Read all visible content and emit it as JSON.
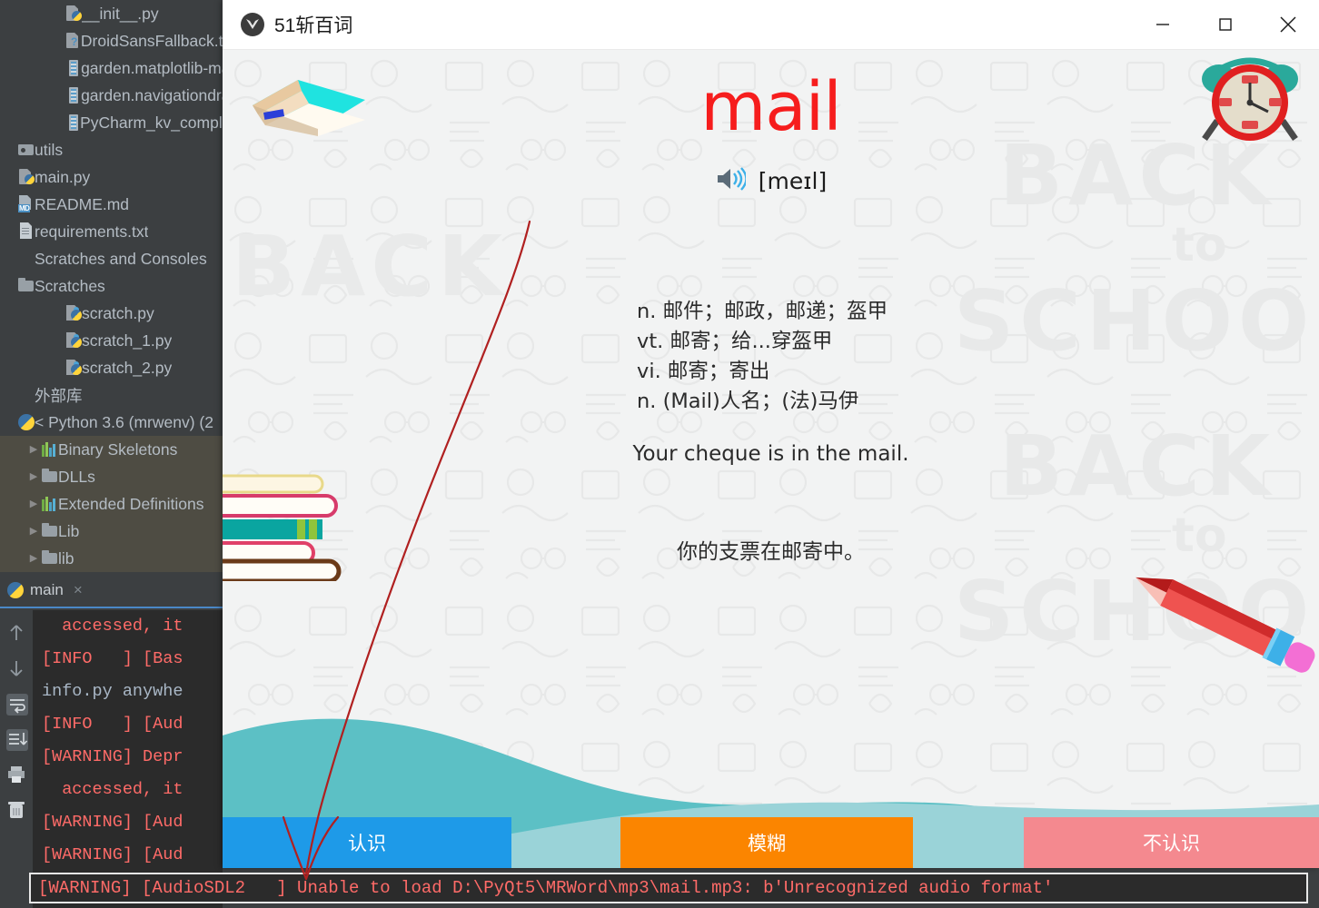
{
  "ide": {
    "tree": {
      "items": [
        {
          "label": "__init__.py",
          "icon": "python-file-icon",
          "indent": 2,
          "arrow": "",
          "selected": false
        },
        {
          "label": "DroidSansFallback.ttf",
          "icon": "unknown-file-icon",
          "indent": 2,
          "arrow": "",
          "selected": false
        },
        {
          "label": "garden.matplotlib-ma",
          "icon": "kv-file-icon",
          "indent": 2,
          "arrow": "",
          "selected": false
        },
        {
          "label": "garden.navigationdra",
          "icon": "kv-file-icon",
          "indent": 2,
          "arrow": "",
          "selected": false
        },
        {
          "label": "PyCharm_kv_completi",
          "icon": "kv-file-icon",
          "indent": 2,
          "arrow": "",
          "selected": false
        },
        {
          "label": "utils",
          "icon": "folder-module-icon",
          "indent": 0,
          "arrow": "",
          "selected": false
        },
        {
          "label": "main.py",
          "icon": "python-file-icon",
          "indent": 0,
          "arrow": "",
          "selected": false
        },
        {
          "label": "README.md",
          "icon": "markdown-file-icon",
          "indent": 0,
          "arrow": "",
          "selected": false
        },
        {
          "label": "requirements.txt",
          "icon": "text-file-icon",
          "indent": 0,
          "arrow": "",
          "selected": false
        },
        {
          "label": "Scratches and Consoles",
          "icon": "none",
          "indent": 0,
          "arrow": "",
          "selected": false
        },
        {
          "label": "Scratches",
          "icon": "folder-icon",
          "indent": 0,
          "arrow": "",
          "selected": false
        },
        {
          "label": "scratch.py",
          "icon": "scratch-file-icon",
          "indent": 2,
          "arrow": "",
          "selected": false
        },
        {
          "label": "scratch_1.py",
          "icon": "scratch-file-icon",
          "indent": 2,
          "arrow": "",
          "selected": false
        },
        {
          "label": "scratch_2.py",
          "icon": "scratch-file-icon",
          "indent": 2,
          "arrow": "",
          "selected": false
        },
        {
          "label": "外部库",
          "icon": "none",
          "indent": 0,
          "arrow": "",
          "selected": false
        },
        {
          "label": "< Python 3.6 (mrwenv) (2",
          "icon": "python-interpreter-icon",
          "indent": 0,
          "arrow": "",
          "selected": false
        },
        {
          "label": "Binary Skeletons",
          "icon": "skeleton-bars-icon",
          "indent": 1,
          "arrow": "▶",
          "selected": true
        },
        {
          "label": "DLLs",
          "icon": "folder-icon",
          "indent": 1,
          "arrow": "▶",
          "selected": true
        },
        {
          "label": "Extended Definitions",
          "icon": "skeleton-bars-icon",
          "indent": 1,
          "arrow": "▶",
          "selected": true
        },
        {
          "label": "Lib",
          "icon": "folder-icon",
          "indent": 1,
          "arrow": "▶",
          "selected": true
        },
        {
          "label": "lib",
          "icon": "folder-icon",
          "indent": 1,
          "arrow": "▶",
          "selected": true
        }
      ]
    },
    "run_tab": {
      "label": "main",
      "close_label": "×",
      "icon": "python-run-icon"
    },
    "gutter_icons": [
      "arrow-up-icon",
      "arrow-down-icon",
      "soft-wrap-icon",
      "scroll-to-end-icon",
      "print-icon",
      "trash-icon"
    ],
    "console_lines": [
      {
        "text": "  accessed, it",
        "muted": false
      },
      {
        "text": "[INFO   ] [Bas",
        "muted": false
      },
      {
        "text": "info.py anywhe",
        "muted": true
      },
      {
        "text": "[INFO   ] [Aud",
        "muted": false
      },
      {
        "text": "[WARNING] Depr",
        "muted": false
      },
      {
        "text": "  accessed, it",
        "muted": false
      },
      {
        "text": "[WARNING] [Aud",
        "muted": false
      },
      {
        "text": "[WARNING] [Aud",
        "muted": false
      }
    ],
    "warning_line": "[WARNING] [AudioSDL2   ] Unable to load D:\\PyQt5\\MRWord\\mp3\\mail.mp3: b'Unrecognized audio format'"
  },
  "app": {
    "title": "51斩百词",
    "logo_icon": "app-logo-icon",
    "window_controls": {
      "minimize": "minimize-icon",
      "maximize": "maximize-icon",
      "close": "close-icon"
    },
    "word": "mail",
    "speaker_icon": "speaker-icon",
    "phonetic": "[meɪl]",
    "definitions": [
      "n. 邮件；邮政，邮递；盔甲",
      "vt. 邮寄；给...穿盔甲",
      "vi. 邮寄；寄出",
      "n. (Mail)人名；(法)马伊"
    ],
    "example_sentence": "Your cheque is in the mail.",
    "example_translation": "你的支票在邮寄中。",
    "buttons": [
      {
        "label": "认识",
        "color": "#1e9ae8"
      },
      {
        "label": "模糊",
        "color": "#fb8500"
      },
      {
        "label": "不认识",
        "color": "#f4898f"
      }
    ],
    "watermark": {
      "line1": "BACK",
      "line2": "to",
      "line3": "SCHOOL"
    },
    "decor": {
      "book_icon": "open-book-icon",
      "clock_icon": "alarm-clock-icon",
      "book_stack_icon": "book-stack-icon",
      "pencil_icon": "pencil-icon"
    },
    "colors": {
      "word": "#f61d1d",
      "wave_dark": "#5cc0c5",
      "wave_light": "#9ad3d8",
      "background": "#f2f3f3"
    }
  }
}
